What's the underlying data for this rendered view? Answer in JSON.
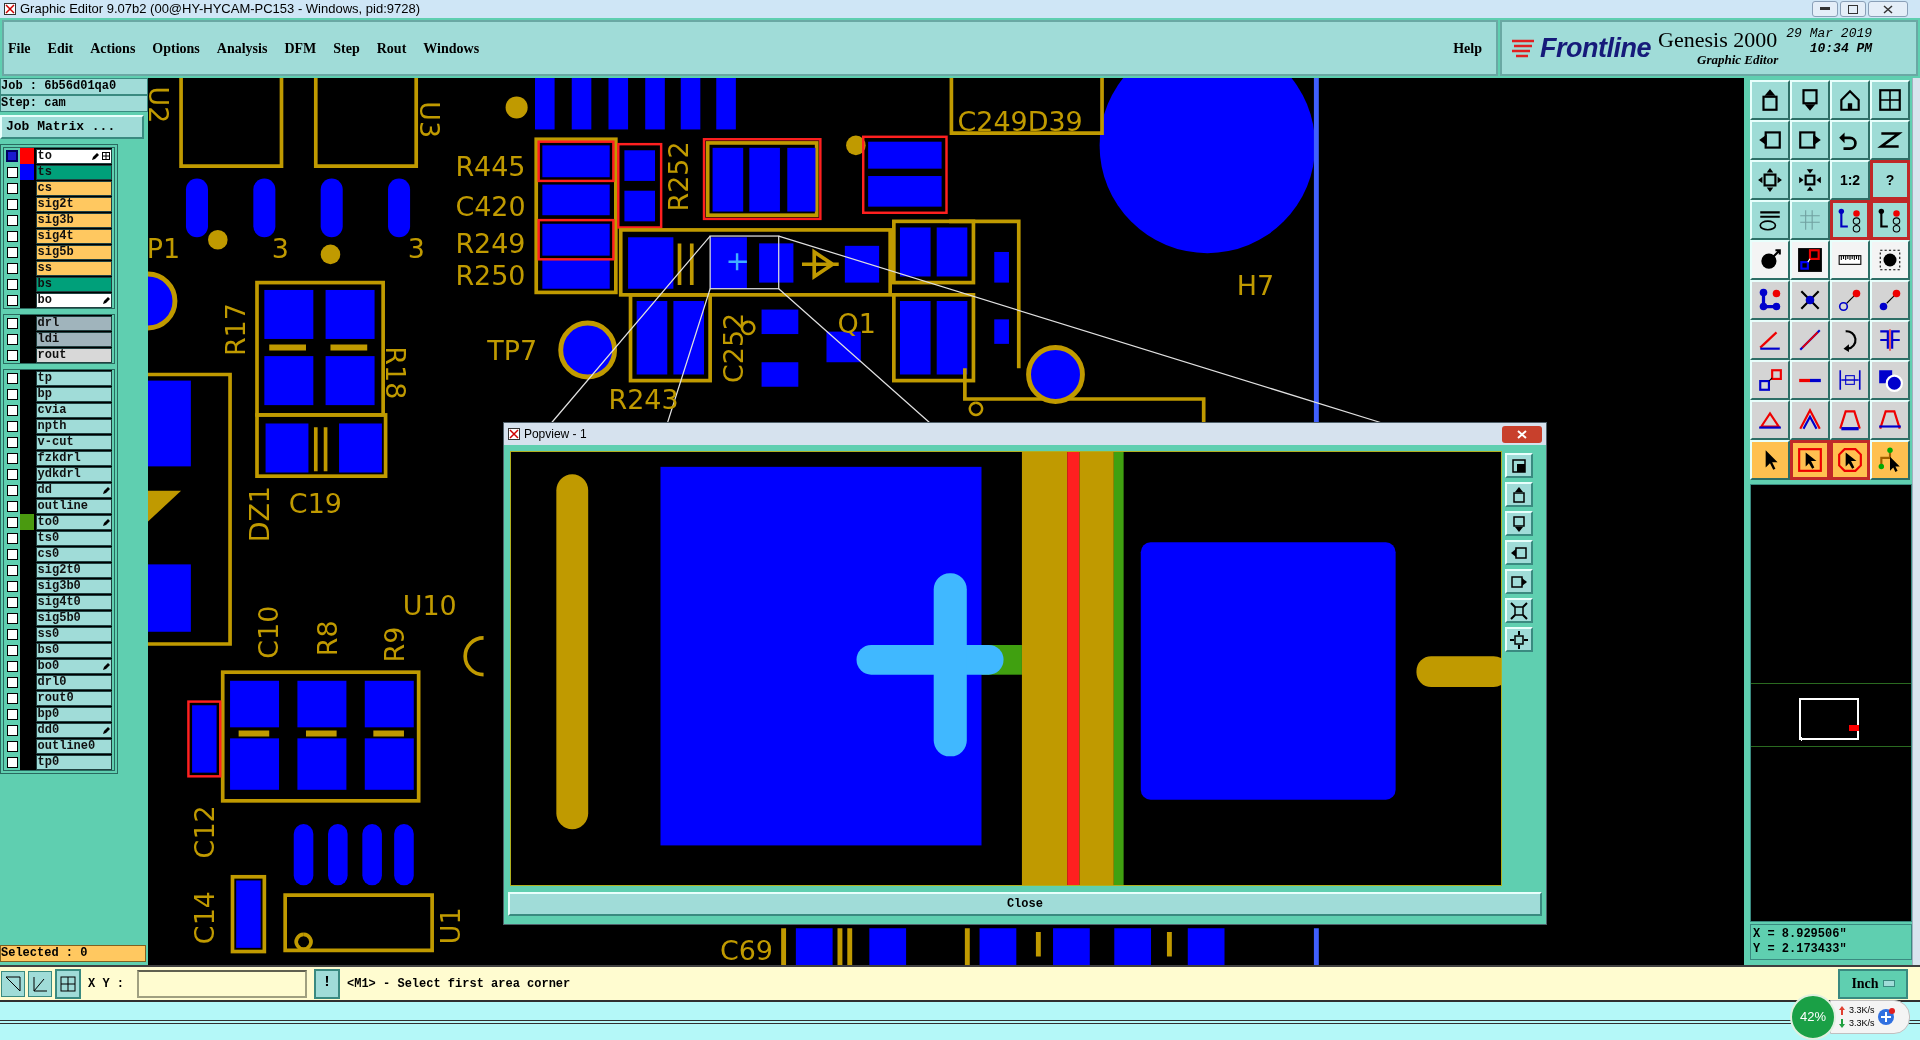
{
  "window": {
    "title": "Graphic Editor 9.07b2 (00@HY-HYCAM-PC153 - Windows, pid:9728)"
  },
  "menu": [
    "File",
    "Edit",
    "Actions",
    "Options",
    "Analysis",
    "DFM",
    "Step",
    "Rout",
    "Windows"
  ],
  "help": "Help",
  "branding": {
    "company": "Frontline",
    "product": "Genesis 2000",
    "module": "Graphic Editor",
    "date": "29 Mar 2019",
    "time": "10:34 PM"
  },
  "job": {
    "job": "Job : 6b56d01qa0",
    "step": "Step: cam",
    "matrix_button": "Job Matrix ..."
  },
  "layers": [
    [
      {
        "name": "to",
        "kind": "silk",
        "color": "#ff0000",
        "selected": true,
        "editable": true
      },
      {
        "name": "ts",
        "kind": "mask",
        "color": "#0000ff",
        "selected": false,
        "editable": false
      },
      {
        "name": "cs",
        "kind": "signal",
        "selected": false,
        "editable": false
      },
      {
        "name": "sig2t",
        "kind": "signal",
        "selected": false,
        "editable": false
      },
      {
        "name": "sig3b",
        "kind": "signal",
        "selected": false,
        "editable": false
      },
      {
        "name": "sig4t",
        "kind": "signal",
        "selected": false,
        "editable": false
      },
      {
        "name": "sig5b",
        "kind": "signal",
        "selected": false,
        "editable": false
      },
      {
        "name": "ss",
        "kind": "signal",
        "selected": false,
        "editable": false
      },
      {
        "name": "bs",
        "kind": "mask",
        "selected": false,
        "editable": false
      },
      {
        "name": "bo",
        "kind": "silk",
        "selected": false,
        "editable": true
      }
    ],
    [
      {
        "name": "drl",
        "kind": "drill",
        "selected": false,
        "editable": false
      },
      {
        "name": "ldi",
        "kind": "drill",
        "selected": false,
        "editable": false
      },
      {
        "name": "rout",
        "kind": "rout",
        "selected": false,
        "editable": false
      }
    ],
    [
      {
        "name": "tp",
        "kind": "misc",
        "selected": false,
        "editable": false
      },
      {
        "name": "bp",
        "kind": "misc",
        "selected": false,
        "editable": false
      },
      {
        "name": "cvia",
        "kind": "misc",
        "selected": false,
        "editable": false
      },
      {
        "name": "npth",
        "kind": "misc",
        "selected": false,
        "editable": false
      },
      {
        "name": "v-cut",
        "kind": "misc",
        "selected": false,
        "editable": false
      },
      {
        "name": "fzkdrl",
        "kind": "misc",
        "selected": false,
        "editable": false
      },
      {
        "name": "ydkdrl",
        "kind": "misc",
        "selected": false,
        "editable": false
      },
      {
        "name": "dd",
        "kind": "misc",
        "selected": false,
        "editable": true
      },
      {
        "name": "outline",
        "kind": "misc",
        "selected": false,
        "editable": false
      },
      {
        "name": "to0",
        "kind": "misc",
        "color": "#4a9a10",
        "selected": false,
        "editable": true
      },
      {
        "name": "ts0",
        "kind": "misc",
        "selected": false,
        "editable": false
      },
      {
        "name": "cs0",
        "kind": "misc",
        "selected": false,
        "editable": false
      },
      {
        "name": "sig2t0",
        "kind": "misc",
        "selected": false,
        "editable": false
      },
      {
        "name": "sig3b0",
        "kind": "misc",
        "selected": false,
        "editable": false
      },
      {
        "name": "sig4t0",
        "kind": "misc",
        "selected": false,
        "editable": false
      },
      {
        "name": "sig5b0",
        "kind": "misc",
        "selected": false,
        "editable": false
      },
      {
        "name": "ss0",
        "kind": "misc",
        "selected": false,
        "editable": false
      },
      {
        "name": "bs0",
        "kind": "misc",
        "selected": false,
        "editable": false
      },
      {
        "name": "bo0",
        "kind": "misc",
        "selected": false,
        "editable": true
      },
      {
        "name": "drl0",
        "kind": "misc",
        "selected": false,
        "editable": false
      },
      {
        "name": "rout0",
        "kind": "misc",
        "selected": false,
        "editable": false
      },
      {
        "name": "bp0",
        "kind": "misc",
        "selected": false,
        "editable": false
      },
      {
        "name": "dd0",
        "kind": "misc",
        "selected": false,
        "editable": true
      },
      {
        "name": "outline0",
        "kind": "misc",
        "selected": false,
        "editable": false
      },
      {
        "name": "tp0",
        "kind": "misc",
        "selected": false,
        "editable": false
      }
    ]
  ],
  "selected_count": "Selected : 0",
  "canvas": {
    "labels": [
      "U2",
      "U3",
      "R445",
      "C420",
      "R249",
      "R250",
      "R252",
      "C249D39",
      "P1",
      "3",
      "3",
      "H7",
      "R17",
      "R18",
      "TP7",
      "Q1",
      "C252",
      "R243",
      "C19",
      "DZ1",
      "C10",
      "R8",
      "R9",
      "U10",
      "C12",
      "C14",
      "U1",
      "C69"
    ]
  },
  "popview": {
    "title": "Popview - 1",
    "close_button": "Close"
  },
  "toolbar": [
    {
      "kind": "icon",
      "highlighted": false
    },
    {
      "kind": "icon",
      "highlighted": false
    },
    {
      "kind": "icon",
      "highlighted": false
    },
    {
      "kind": "icon",
      "highlighted": false
    },
    {
      "kind": "icon",
      "highlighted": false
    },
    {
      "kind": "icon",
      "highlighted": false
    },
    {
      "kind": "icon",
      "highlighted": false
    },
    {
      "kind": "icon",
      "highlighted": false
    },
    {
      "kind": "icon",
      "highlighted": false
    },
    {
      "kind": "icon",
      "highlighted": false
    },
    {
      "kind": "text",
      "label": "1:2",
      "highlighted": false
    },
    {
      "kind": "text",
      "label": "?",
      "highlighted": true
    },
    {
      "kind": "icon",
      "highlighted": false
    },
    {
      "kind": "icon",
      "highlighted": false
    },
    {
      "kind": "icon",
      "highlighted": true
    },
    {
      "kind": "icon",
      "highlighted": true
    },
    {
      "kind": "icon",
      "highlighted": false
    },
    {
      "kind": "icon",
      "highlighted": false
    },
    {
      "kind": "icon",
      "highlighted": false
    },
    {
      "kind": "icon",
      "highlighted": false
    },
    {
      "kind": "icon",
      "highlighted": false
    },
    {
      "kind": "icon",
      "highlighted": false
    },
    {
      "kind": "icon",
      "highlighted": false
    },
    {
      "kind": "icon",
      "highlighted": false
    },
    {
      "kind": "icon",
      "highlighted": false
    },
    {
      "kind": "icon",
      "highlighted": false
    },
    {
      "kind": "icon",
      "highlighted": false
    },
    {
      "kind": "icon",
      "highlighted": false
    },
    {
      "kind": "icon",
      "highlighted": false
    },
    {
      "kind": "icon",
      "highlighted": false
    },
    {
      "kind": "icon",
      "highlighted": false
    },
    {
      "kind": "icon",
      "highlighted": false
    },
    {
      "kind": "icon",
      "highlighted": false
    },
    {
      "kind": "icon",
      "highlighted": false
    },
    {
      "kind": "icon",
      "highlighted": false
    },
    {
      "kind": "icon",
      "highlighted": false
    },
    {
      "kind": "icon",
      "highlighted": false
    },
    {
      "kind": "icon",
      "highlighted": true
    },
    {
      "kind": "icon",
      "highlighted": true
    },
    {
      "kind": "icon",
      "highlighted": false
    }
  ],
  "coordinates": {
    "x": "X = 8.929506\"",
    "y": "Y = 2.173433\""
  },
  "status_bar": {
    "xy_label": "X Y :",
    "confirm_button": "!",
    "prompt": "<M1> - Select first area corner",
    "units": "Inch"
  },
  "tray_widget": {
    "percent": "42%",
    "upload": "3.3K/s",
    "download": "3.3K/s"
  }
}
